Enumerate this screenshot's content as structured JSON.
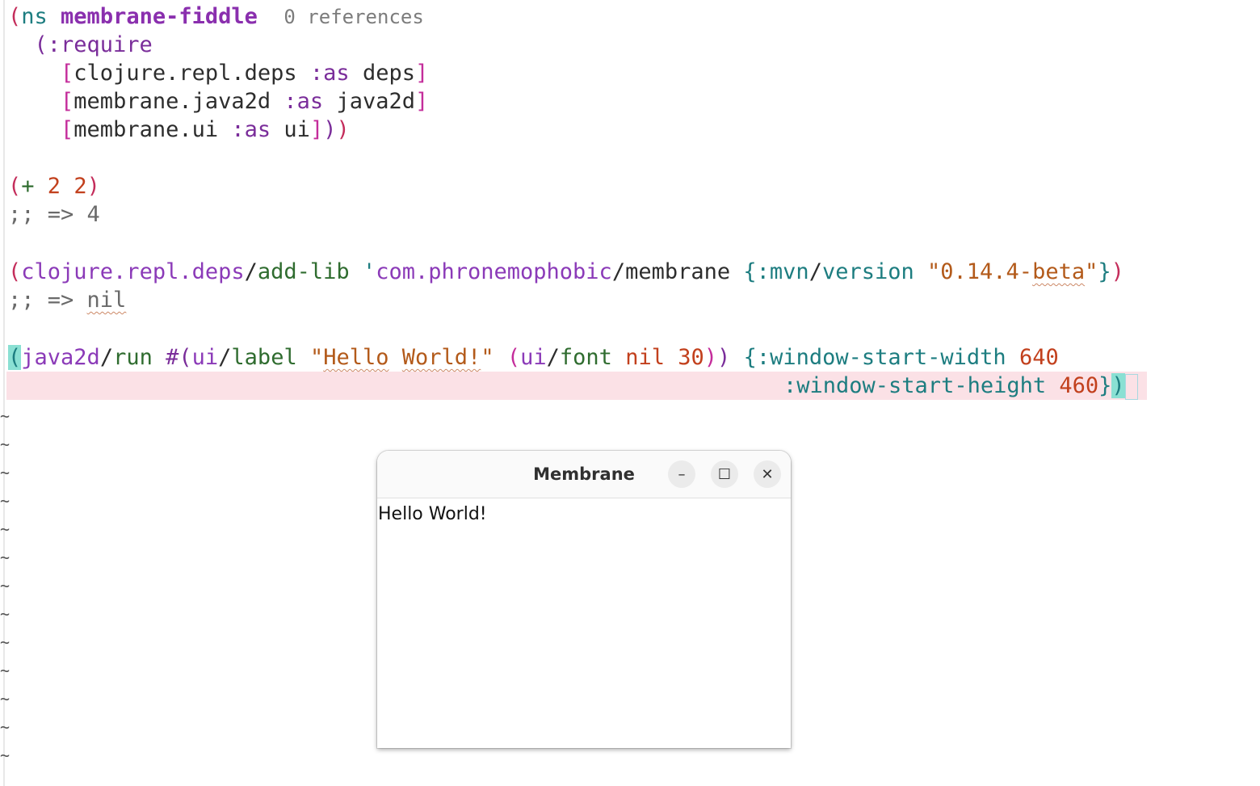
{
  "editor": {
    "ns_line": {
      "open": "(",
      "ns_kw": "ns",
      "ns_name": "membrane-fiddle",
      "refs": "0 references"
    },
    "require_line": {
      "text": "(:require"
    },
    "req1": {
      "lib": "clojure.repl.deps",
      "as": ":as",
      "alias": "deps"
    },
    "req2": {
      "lib": "membrane.java2d",
      "as": ":as",
      "alias": "java2d"
    },
    "req3": {
      "lib": "membrane.ui",
      "as": ":as",
      "alias": "ui"
    },
    "add_expr": {
      "op": "+",
      "a": "2",
      "b": "2"
    },
    "add_result": {
      "prefix": ";; =>",
      "value": "4"
    },
    "addlib": {
      "ns": "clojure.repl.deps",
      "fn": "add-lib",
      "quote": "'",
      "group": "com.phronemophobic",
      "artifact": "membrane",
      "key": ":mvn",
      "key2": "version",
      "ver_q1": "\"0.14.4-",
      "ver_beta": "beta",
      "ver_q2": "\""
    },
    "addlib_result": {
      "prefix": ";; =>",
      "value": "nil"
    },
    "run": {
      "ns": "java2d",
      "fn": "run",
      "hash": "#(",
      "ui_ns": "ui",
      "label_fn": "label",
      "str_q1": "\"",
      "str_w1": "Hello",
      "str_w2": "World!",
      "str_q2": "\"",
      "font_ns": "ui",
      "font_fn": "font",
      "nil": "nil",
      "size": "30",
      "k_width": ":window-start-width",
      "v_width": "640",
      "k_height": ":window-start-height",
      "v_height": "460"
    }
  },
  "window": {
    "title": "Membrane",
    "minimize_glyph": "–",
    "maximize_glyph": "☐",
    "close_glyph": "✕",
    "label": "Hello World!"
  }
}
